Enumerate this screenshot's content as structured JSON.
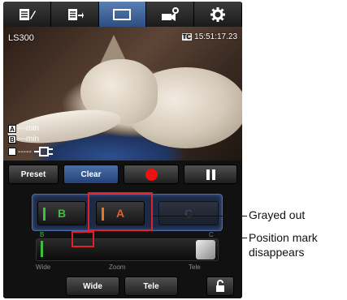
{
  "tabs": [
    {
      "name": "tab-notes",
      "icon": "notepad-pencil-icon"
    },
    {
      "name": "tab-metadata",
      "icon": "list-export-icon"
    },
    {
      "name": "tab-viewfinder",
      "icon": "monitor-icon"
    },
    {
      "name": "tab-camera-settings",
      "icon": "camera-gear-icon"
    },
    {
      "name": "tab-settings",
      "icon": "gear-icon"
    }
  ],
  "video": {
    "clip_name": "LS300",
    "timecode_badge": "TC",
    "timecode": "15:51:17.23",
    "marker_a": "A",
    "marker_b": "B",
    "min_a": "---min",
    "min_b": "---min",
    "battery_text": "-----"
  },
  "controls": {
    "preset_label": "Preset",
    "clear_label": "Clear",
    "btn_b_label": "B",
    "btn_a_label": "A",
    "btn_c_label": "C",
    "mark_b": "B",
    "mark_c": "C",
    "zoom_wide": "Wide",
    "zoom_label": "Zoom",
    "zoom_tele": "Tele",
    "wide_button": "Wide",
    "tele_button": "Tele"
  },
  "annotations": {
    "grayed_out": "Grayed out",
    "position_mark_1": "Position mark",
    "position_mark_2": "disappears"
  },
  "colors": {
    "accent_blue": "#2d4f82",
    "rec_red": "#e11111",
    "highlight_red": "#e0202c",
    "bar_green": "#3fbf3f",
    "bar_orange": "#e07a2a"
  }
}
